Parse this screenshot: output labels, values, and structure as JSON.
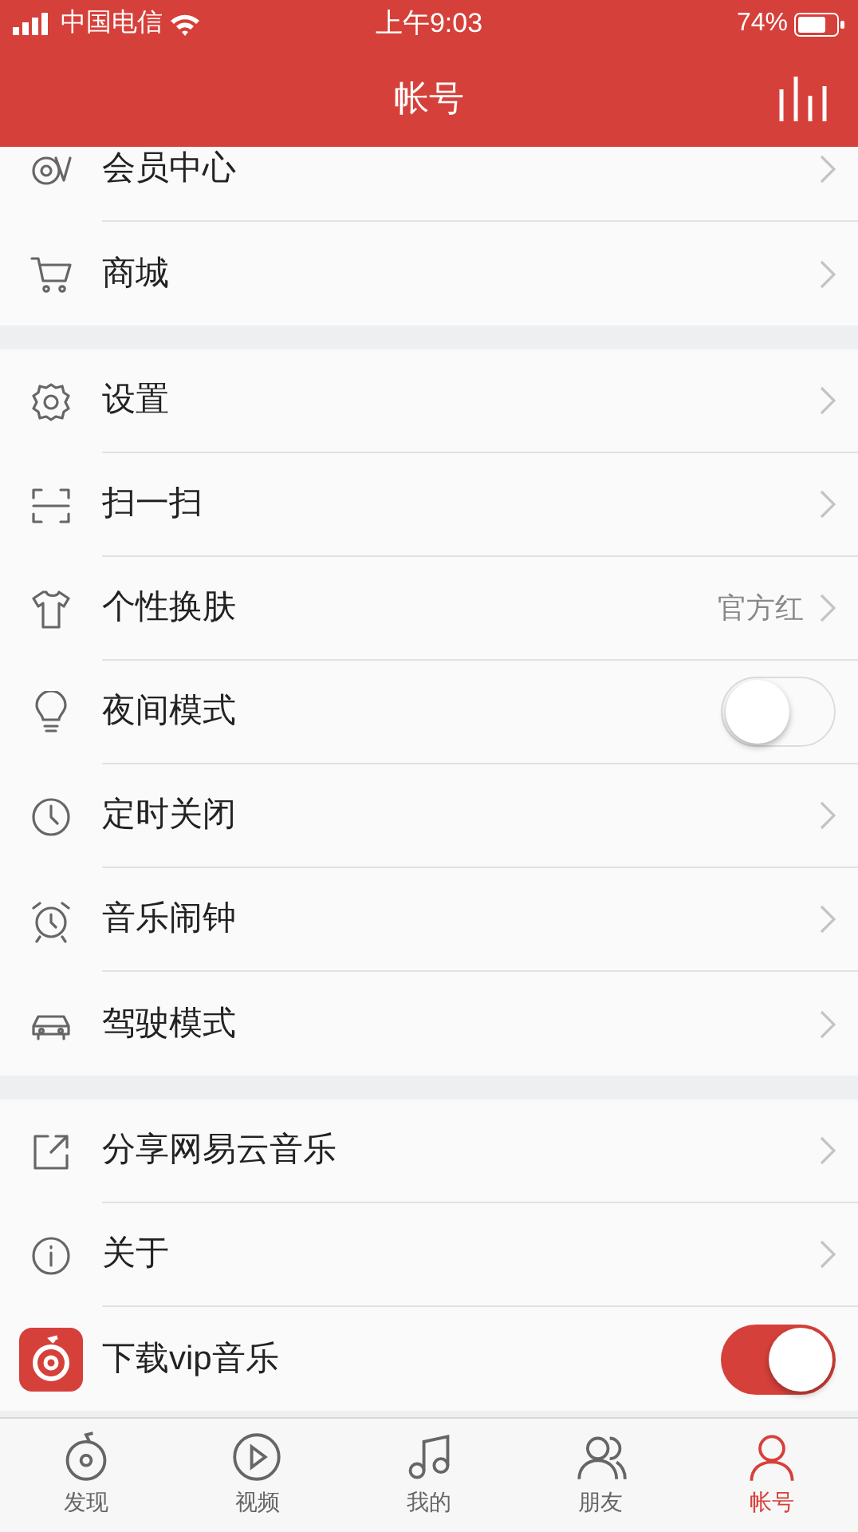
{
  "status_bar": {
    "carrier": "中国电信",
    "time": "上午9:03",
    "battery": "74%"
  },
  "header": {
    "title": "帐号"
  },
  "sections": [
    {
      "items": [
        {
          "kind": "link",
          "label": "会员中心"
        },
        {
          "kind": "link",
          "label": "商城"
        }
      ]
    },
    {
      "items": [
        {
          "kind": "link",
          "label": "设置"
        },
        {
          "kind": "link",
          "label": "扫一扫"
        },
        {
          "kind": "link",
          "label": "个性换肤",
          "value": "官方红"
        },
        {
          "kind": "toggle",
          "label": "夜间模式",
          "on": false
        },
        {
          "kind": "link",
          "label": "定时关闭"
        },
        {
          "kind": "link",
          "label": "音乐闹钟"
        },
        {
          "kind": "link",
          "label": "驾驶模式"
        }
      ]
    },
    {
      "items": [
        {
          "kind": "link",
          "label": "分享网易云音乐"
        },
        {
          "kind": "link",
          "label": "关于"
        },
        {
          "kind": "toggle",
          "label": "下载vip音乐",
          "on": true
        }
      ]
    }
  ],
  "tabs": [
    {
      "label": "发现",
      "selected": false
    },
    {
      "label": "视频",
      "selected": false
    },
    {
      "label": "我的",
      "selected": false
    },
    {
      "label": "朋友",
      "selected": false
    },
    {
      "label": "帐号",
      "selected": true
    }
  ]
}
